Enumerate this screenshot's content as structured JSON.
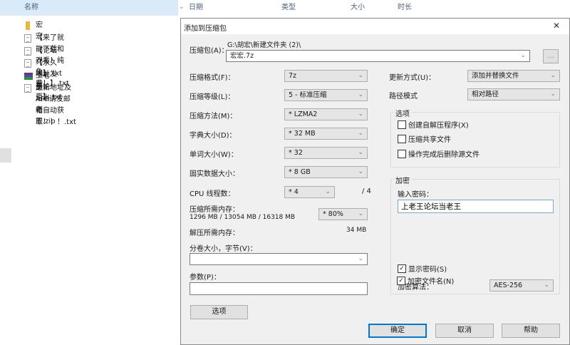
{
  "explorer": {
    "columns": [
      "名称",
      "日期",
      "类型",
      "大小",
      "时长"
    ],
    "files": [
      {
        "name": "宏宏",
        "type": "folder"
      },
      {
        "name": "【来了就能下载和观看！纯免费！】.txt",
        "type": "txt"
      },
      {
        "name": "【论坛介绍】.txt",
        "type": "txt"
      },
      {
        "name": "【永久地址发布页】.txt",
        "type": "txt"
      },
      {
        "name": "上老王论坛当老王.zip",
        "type": "zip"
      },
      {
        "name": "最新地址及APP请发邮箱自动获取！！！.txt",
        "type": "txt"
      }
    ]
  },
  "dialog": {
    "title": "添加到压缩包",
    "close": "✕",
    "archive_label": "压缩包(A)：",
    "archive_path": "G:\\胡宏\\新建文件夹 (2)\\",
    "archive_name": "宏宏.7z",
    "browse_label": "...",
    "format_label": "压缩格式(F)：",
    "format_value": "7z",
    "level_label": "压缩等级(L)：",
    "level_value": "5 - 标准压缩",
    "method_label": "压缩方法(M)：",
    "method_value": "* LZMA2",
    "dict_label": "字典大小(D)：",
    "dict_value": "* 32 MB",
    "word_label": "单词大小(W)：",
    "word_value": "* 32",
    "solid_label": "固实数据大小：",
    "solid_value": "* 8 GB",
    "cpu_label": "CPU 线程数：",
    "cpu_value": "* 4",
    "cpu_max": "/ 4",
    "mem_label": "压缩所需内存：",
    "mem_detail": "1296 MB / 13054 MB / 16318 MB",
    "mem_value": "* 80%",
    "decomp_label": "解压所需内存：",
    "decomp_value": "34 MB",
    "split_label": "分卷大小，字节(V)：",
    "split_value": "",
    "params_label": "参数(P)：",
    "params_value": "",
    "options_button": "选项",
    "update_label": "更新方式(U)：",
    "update_value": "添加并替换文件",
    "pathmode_label": "路径模式",
    "pathmode_value": "相对路径",
    "options_group": "选项",
    "opt_sfx": {
      "label": "创建自解压程序(X)",
      "checked": false
    },
    "opt_shared": {
      "label": "压缩共享文件",
      "checked": false
    },
    "opt_delete": {
      "label": "操作完成后删除源文件",
      "checked": false
    },
    "encrypt_group": "加密",
    "password_label": "输入密码：",
    "password_value": "上老王论坛当老王",
    "show_password": {
      "label": "显示密码(S)",
      "checked": true
    },
    "algo_label": "加密算法：",
    "algo_value": "AES-256",
    "encrypt_names": {
      "label": "加密文件名(N)",
      "checked": true
    },
    "ok": "确定",
    "cancel": "取消",
    "help": "帮助"
  }
}
